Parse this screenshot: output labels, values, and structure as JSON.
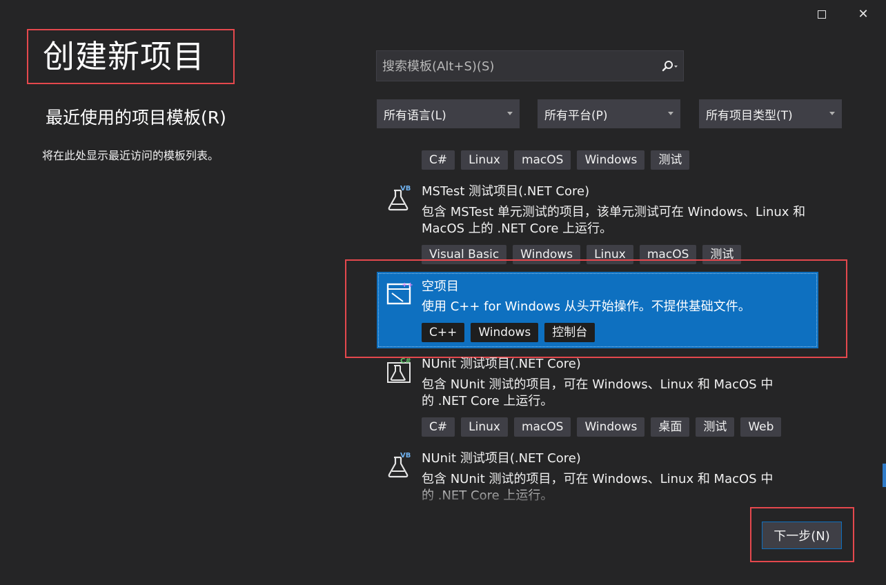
{
  "window": {
    "maximize_icon": "maximize-icon",
    "close_icon": "close-icon",
    "close_glyph": "✕"
  },
  "page": {
    "title": "创建新项目",
    "recent_heading": "最近使用的项目模板(R)",
    "recent_description": "将在此处显示最近访问的模板列表。"
  },
  "search": {
    "placeholder": "搜索模板(Alt+S)(S)",
    "icon": "search-icon"
  },
  "filters": {
    "language": "所有语言(L)",
    "platform": "所有平台(P)",
    "project_type": "所有项目类型(T)"
  },
  "templates": [
    {
      "tags": [
        "C#",
        "Linux",
        "macOS",
        "Windows",
        "测试"
      ]
    },
    {
      "name": "MSTest 测试项目(.NET Core)",
      "description": "包含 MSTest 单元测试的项目，该单元测试可在 Windows、Linux 和 MacOS 上的 .NET Core 上运行。",
      "icon": "vb-flask-icon",
      "icon_badge": "VB",
      "tags": [
        "Visual Basic",
        "Windows",
        "Linux",
        "macOS",
        "测试"
      ]
    },
    {
      "name": "空项目",
      "description": "使用 C++ for Windows 从头开始操作。不提供基础文件。",
      "icon": "empty-project-icon",
      "icon_badge": "++",
      "tags": [
        "C++",
        "Windows",
        "控制台"
      ],
      "selected": true
    },
    {
      "name": "NUnit 测试项目(.NET Core)",
      "description": "包含 NUnit 测试的项目，可在 Windows、Linux 和 MacOS 中的 .NET Core 上运行。",
      "icon": "csharp-flask-icon",
      "icon_badge": "C#",
      "tags": [
        "C#",
        "Linux",
        "macOS",
        "Windows",
        "桌面",
        "测试",
        "Web"
      ]
    },
    {
      "name": "NUnit 测试项目(.NET Core)",
      "description": "包含 NUnit 测试的项目，可在 Windows、Linux 和 MacOS 中的 .NET Core 上运行。",
      "icon": "vb-flask-icon",
      "icon_badge": "VB"
    }
  ],
  "footer": {
    "next_label": "下一步(N)"
  },
  "colors": {
    "background": "#252526",
    "selection": "#0e70c0",
    "highlight_box": "#e5484d",
    "tag_bg": "#3f3f46"
  }
}
